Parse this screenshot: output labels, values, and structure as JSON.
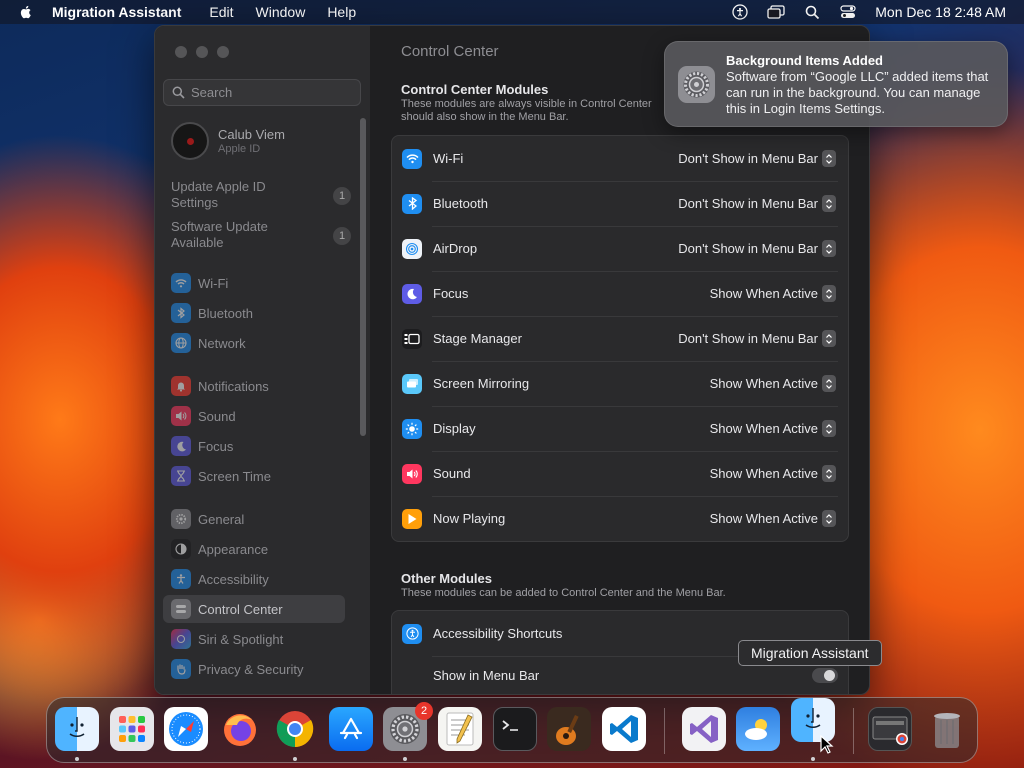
{
  "menubar": {
    "app_name": "Migration Assistant",
    "menus": [
      "Edit",
      "Window",
      "Help"
    ],
    "clock": "Mon Dec 18  2:48 AM"
  },
  "sidebar": {
    "search_placeholder": "Search",
    "profile": {
      "name": "Calub Viem",
      "subtitle": "Apple ID"
    },
    "notices": [
      {
        "label": "Update Apple ID Settings",
        "count": "1"
      },
      {
        "label": "Software Update Available",
        "count": "1"
      }
    ],
    "items": [
      {
        "label": "Wi-Fi"
      },
      {
        "label": "Bluetooth"
      },
      {
        "label": "Network"
      },
      {
        "label": "Notifications"
      },
      {
        "label": "Sound"
      },
      {
        "label": "Focus"
      },
      {
        "label": "Screen Time"
      },
      {
        "label": "General"
      },
      {
        "label": "Appearance"
      },
      {
        "label": "Accessibility"
      },
      {
        "label": "Control Center"
      },
      {
        "label": "Siri & Spotlight"
      },
      {
        "label": "Privacy & Security"
      }
    ],
    "selected": "Control Center"
  },
  "main": {
    "title": "Control Center",
    "modules_section": {
      "title": "Control Center Modules",
      "desc": "These modules are always visible in Control Center should also show in the Menu Bar."
    },
    "modules": [
      {
        "label": "Wi-Fi",
        "value": "Don't Show in Menu Bar",
        "color": "#1f8ef1"
      },
      {
        "label": "Bluetooth",
        "value": "Don't Show in Menu Bar",
        "color": "#1f8ef1"
      },
      {
        "label": "AirDrop",
        "value": "Don't Show in Menu Bar",
        "color": "#eef2f8"
      },
      {
        "label": "Focus",
        "value": "Show When Active",
        "color": "#5e5ce6"
      },
      {
        "label": "Stage Manager",
        "value": "Don't Show in Menu Bar",
        "color": "#1c1c1e"
      },
      {
        "label": "Screen Mirroring",
        "value": "Show When Active",
        "color": "#5ac8fa"
      },
      {
        "label": "Display",
        "value": "Show When Active",
        "color": "#1f8ef1"
      },
      {
        "label": "Sound",
        "value": "Show When Active",
        "color": "#ff375f"
      },
      {
        "label": "Now Playing",
        "value": "Show When Active",
        "color": "#ff9f0a"
      }
    ],
    "other_section": {
      "title": "Other Modules",
      "desc": "These modules can be added to Control Center and the Menu Bar."
    },
    "other_modules": [
      {
        "label": "Accessibility Shortcuts",
        "color": "#1f8ef1"
      }
    ],
    "show_in_menu_bar_label": "Show in Menu Bar"
  },
  "notification": {
    "title": "Background Items Added",
    "body": "Software from “Google LLC” added items that can run in the background. You can manage this in Login Items Settings."
  },
  "tooltip": "Migration Assistant",
  "dock": {
    "settings_badge": "2",
    "apps": [
      "finder-icon",
      "launchpad-icon",
      "safari-icon",
      "firefox-icon",
      "chrome-icon",
      "app-store-icon",
      "system-settings-icon",
      "textedit-icon",
      "terminal-icon",
      "garageband-icon",
      "vscode-icon",
      "visual-studio-icon",
      "weather-icon",
      "migration-assistant-icon",
      "downloads-stack-icon",
      "trash-icon"
    ]
  }
}
